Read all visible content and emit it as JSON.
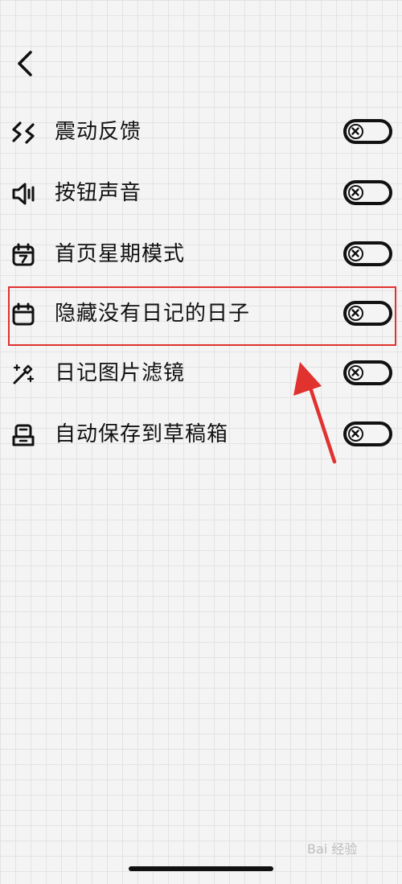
{
  "settings": [
    {
      "label": "震动反馈",
      "icon": "vibration-icon",
      "enabled": false
    },
    {
      "label": "按钮声音",
      "icon": "speaker-icon",
      "enabled": false
    },
    {
      "label": "首页星期模式",
      "icon": "calendar-week-icon",
      "enabled": false
    },
    {
      "label": "隐藏没有日记的日子",
      "icon": "calendar-icon",
      "enabled": false
    },
    {
      "label": "日记图片滤镜",
      "icon": "magic-wand-icon",
      "enabled": false
    },
    {
      "label": "自动保存到草稿箱",
      "icon": "inbox-icon",
      "enabled": false
    }
  ],
  "watermark": "Bai 经验",
  "colors": {
    "highlight": "#e0322f",
    "ink": "#111111"
  }
}
